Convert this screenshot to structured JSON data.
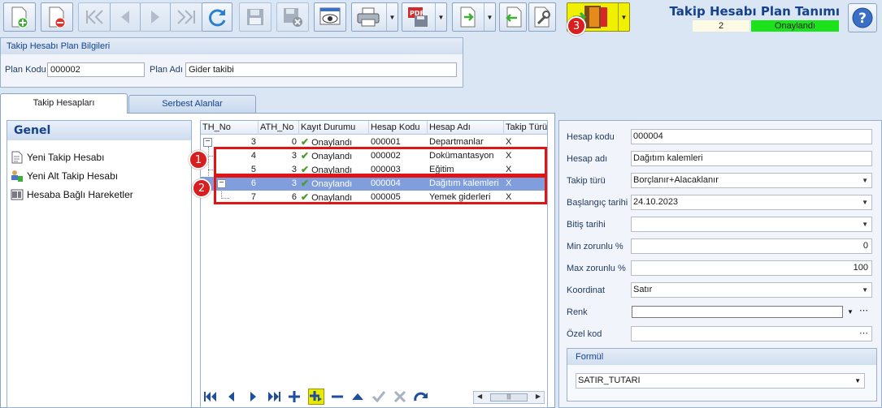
{
  "header": {
    "title": "Takip Hesabı Plan Tanımı",
    "count": "2",
    "status": "Onaylandı",
    "status_color": "#1be21b"
  },
  "toolbar": {
    "buttons": [
      "new-icon",
      "delete-icon",
      "first-icon",
      "prev-icon",
      "next-icon",
      "last-icon",
      "refresh-icon",
      "save-icon",
      "save-delete-icon",
      "preview-icon",
      "print-icon",
      "pdf-icon",
      "export-icon",
      "back-icon",
      "tools-icon",
      "door-exit-icon"
    ],
    "highlight_color": "#f0f000"
  },
  "plan_info": {
    "section_title": "Takip Hesabı Plan Bilgileri",
    "plan_kodu_label": "Plan Kodu",
    "plan_kodu_value": "000002",
    "plan_adi_label": "Plan Adı",
    "plan_adi_value": "Gider takibi"
  },
  "tabs": {
    "takip_hesaplari": "Takip Hesapları",
    "serbest_alanlar": "Serbest Alanlar"
  },
  "left_panel": {
    "title": "Genel",
    "actions": [
      "Yeni Takip Hesabı",
      "Yeni Alt Takip Hesabı",
      "Hesaba Bağlı Hareketler"
    ]
  },
  "grid": {
    "columns": [
      "TH_No",
      "ATH_No",
      "Kayıt Durumu",
      "Hesap Kodu",
      "Hesap Adı",
      "Takip Türü"
    ],
    "rows": [
      {
        "th": "3",
        "ath": "0",
        "durum": "Onaylandı",
        "kod": "000001",
        "ad": "Departmanlar",
        "tur": "X"
      },
      {
        "th": "4",
        "ath": "3",
        "durum": "Onaylandı",
        "kod": "000002",
        "ad": "Dokümantasyon",
        "tur": "X"
      },
      {
        "th": "5",
        "ath": "3",
        "durum": "Onaylandı",
        "kod": "000003",
        "ad": "Eğitim",
        "tur": "X"
      },
      {
        "th": "6",
        "ath": "3",
        "durum": "Onaylandı",
        "kod": "000004",
        "ad": "Dağıtım kalemleri",
        "tur": "X"
      },
      {
        "th": "7",
        "ath": "6",
        "durum": "Onaylandı",
        "kod": "000005",
        "ad": "Yemek giderleri",
        "tur": "X"
      }
    ],
    "selected_row": 3
  },
  "annotations": [
    "1",
    "2",
    "3"
  ],
  "form": {
    "hesap_kodu_label": "Hesap kodu",
    "hesap_kodu": "000004",
    "hesap_adi_label": "Hesap adı",
    "hesap_adi": "Dağıtım kalemleri",
    "takip_turu_label": "Takip türü",
    "takip_turu": "Borçlanır+Alacaklanır",
    "baslangic_label": "Başlangıç tarihi",
    "baslangic": "24.10.2023",
    "bitis_label": "Bitiş tarihi",
    "bitis": "",
    "min_label": "Min zorunlu %",
    "min": "0",
    "max_label": "Max zorunlu %",
    "max": "100",
    "koordinat_label": "Koordinat",
    "koordinat": "Satır",
    "renk_label": "Renk",
    "ozel_kod_label": "Özel kod",
    "formul_title": "Formül",
    "formul": "SATIR_TUTARI"
  }
}
